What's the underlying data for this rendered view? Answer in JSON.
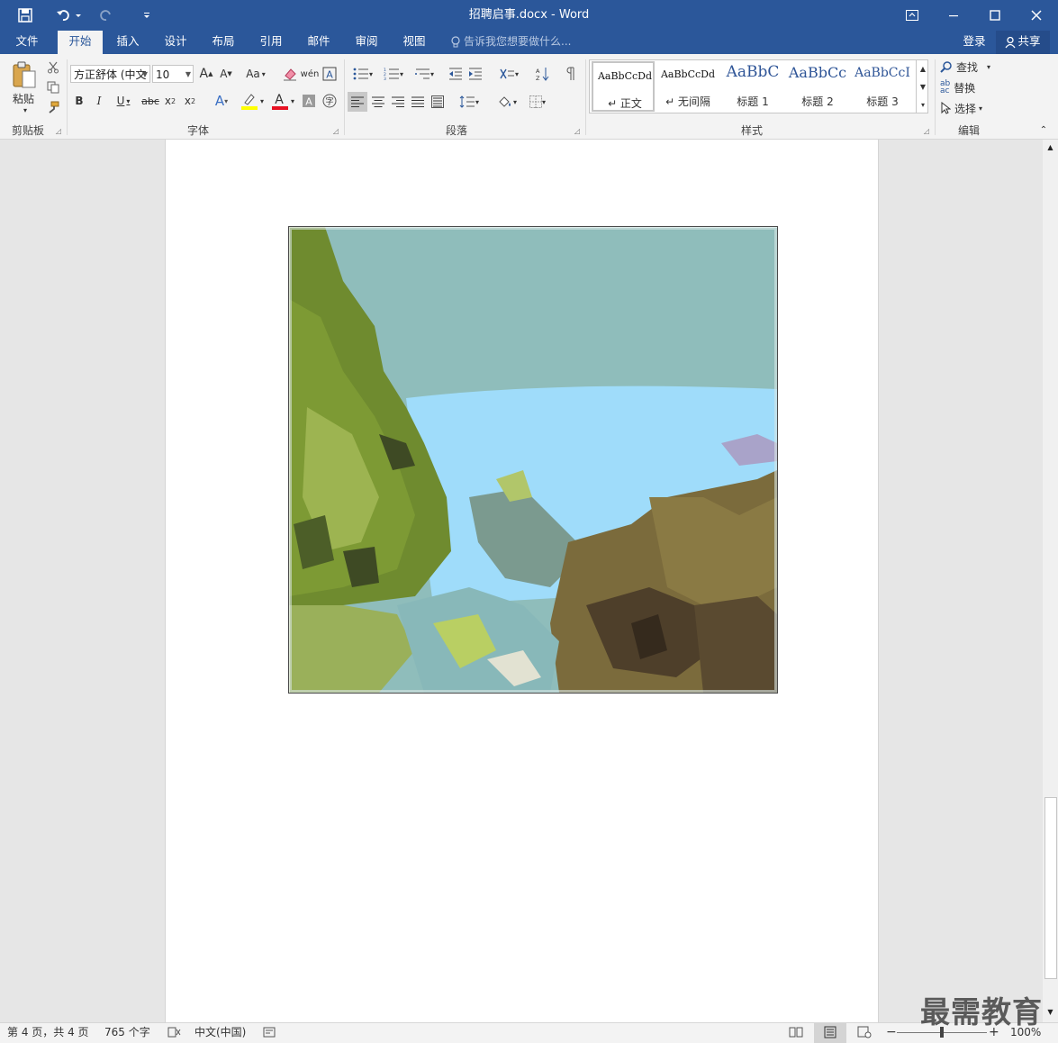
{
  "window": {
    "title": "招聘启事.docx - Word",
    "login": "登录",
    "share": "共享"
  },
  "colors": {
    "accent": "#2b579a",
    "ribbon": "#f3f3f3",
    "font_color_bar": "#e81123",
    "highlight_bar": "#ffff00"
  },
  "tabs": [
    {
      "label": "文件"
    },
    {
      "label": "开始"
    },
    {
      "label": "插入"
    },
    {
      "label": "设计"
    },
    {
      "label": "布局"
    },
    {
      "label": "引用"
    },
    {
      "label": "邮件"
    },
    {
      "label": "审阅"
    },
    {
      "label": "视图"
    }
  ],
  "active_tab": "开始",
  "tellme": {
    "placeholder": "告诉我您想要做什么..."
  },
  "ribbon": {
    "clipboard": {
      "label": "剪贴板",
      "paste": "粘贴"
    },
    "font": {
      "label": "字体",
      "font_name": "方正舒体 (中文",
      "font_size": "10",
      "change_case": "Aa"
    },
    "paragraph": {
      "label": "段落"
    },
    "styles": {
      "label": "样式",
      "items": [
        {
          "preview": "AaBbCcDd",
          "name": "↵ 正文"
        },
        {
          "preview": "AaBbCcDd",
          "name": "↵ 无间隔"
        },
        {
          "preview": "AaBbC",
          "name": "标题 1"
        },
        {
          "preview": "AaBbCc",
          "name": "标题 2"
        },
        {
          "preview": "AaBbCcI",
          "name": "标题 3"
        }
      ]
    },
    "editing": {
      "label": "编辑",
      "find": "查找",
      "replace": "替换",
      "select": "选择"
    }
  },
  "status": {
    "page": "第 4 页，共 4 页",
    "words": "765 个字",
    "language": "中文(中国)",
    "zoom": "100%",
    "zoom_fraction": 0.5
  },
  "watermark": "最需教育"
}
